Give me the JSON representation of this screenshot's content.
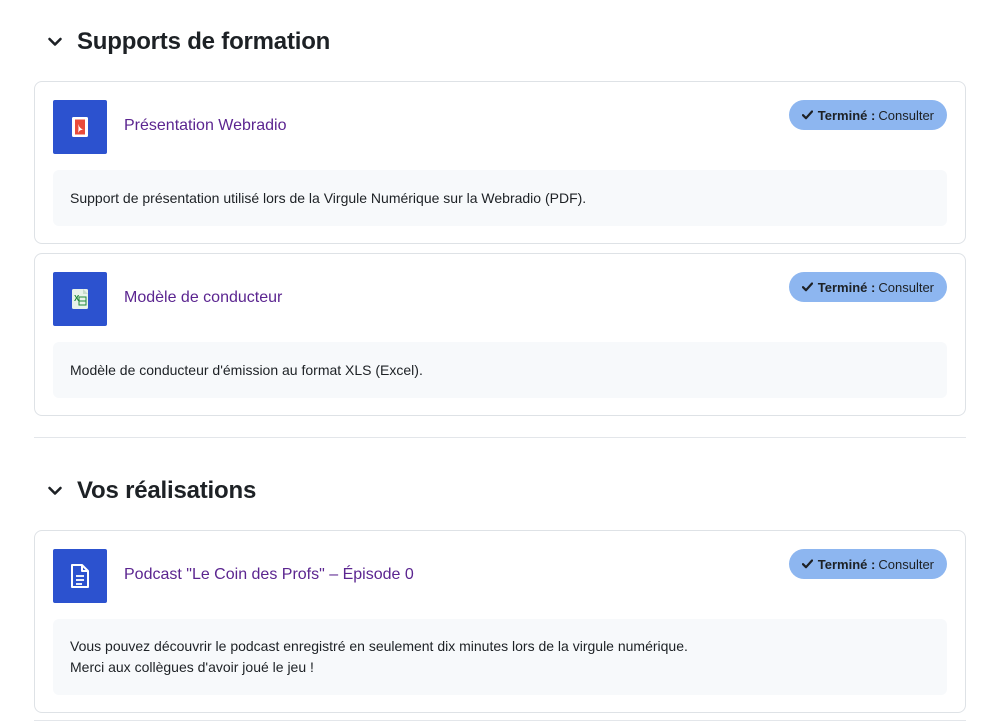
{
  "sections": [
    {
      "title": "Supports de formation",
      "activities": [
        {
          "icon": "pdf-file-icon",
          "title": "Présentation Webradio",
          "status": "Terminé :",
          "action": "Consulter",
          "description_lines": [
            "Support de présentation utilisé lors de la Virgule Numérique sur la Webradio (PDF)."
          ]
        },
        {
          "icon": "excel-file-icon",
          "title": "Modèle de conducteur",
          "status": "Terminé :",
          "action": "Consulter",
          "description_lines": [
            "Modèle de conducteur d'émission au format XLS (Excel)."
          ]
        }
      ]
    },
    {
      "title": "Vos réalisations",
      "activities": [
        {
          "icon": "page-document-icon",
          "title": "Podcast \"Le Coin des Profs\" – Épisode 0",
          "status": "Terminé :",
          "action": "Consulter",
          "description_lines": [
            "Vous pouvez découvrir le podcast enregistré en seulement dix minutes lors de la virgule numérique.",
            "Merci aux collègues d'avoir joué le jeu !"
          ]
        }
      ]
    }
  ],
  "colors": {
    "accent_icon_bg": "#2c52cf",
    "link": "#5b2590",
    "badge_bg": "#8db6f0",
    "description_bg": "#f7f9fb"
  }
}
